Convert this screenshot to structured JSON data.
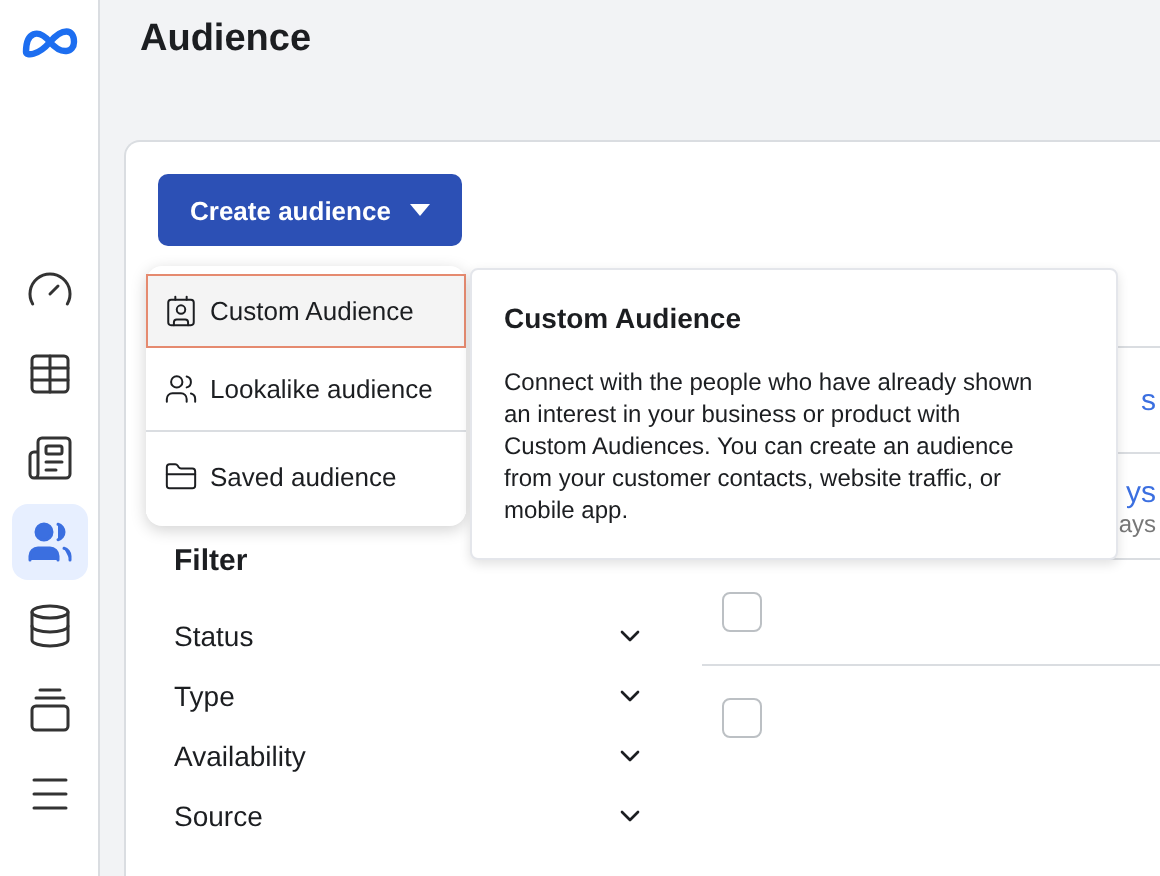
{
  "sidebar": {
    "items": [
      {
        "selected": false
      },
      {
        "selected": false
      },
      {
        "selected": false
      },
      {
        "selected": true
      },
      {
        "selected": false
      },
      {
        "selected": false
      },
      {
        "selected": false
      }
    ]
  },
  "page_title": "Audience",
  "create_button": {
    "label": "Create audience",
    "expanded": true
  },
  "dropdown": {
    "items": [
      {
        "label": "Custom Audience",
        "selected": true
      },
      {
        "label": "Lookalike audience",
        "selected": false
      },
      {
        "label": "Saved audience",
        "selected": false
      }
    ]
  },
  "tooltip": {
    "title": "Custom Audience",
    "body": "Connect with the people who have already shown an interest in your business or product with Custom Audiences. You can create an audience from your customer contacts, website traffic, or mobile app."
  },
  "filter": {
    "title": "Filter",
    "items": [
      {
        "label": "Status",
        "expanded": false
      },
      {
        "label": "Type",
        "expanded": false
      },
      {
        "label": "Availability",
        "expanded": false
      },
      {
        "label": "Source",
        "expanded": false
      }
    ]
  },
  "table": {
    "rows": [
      {
        "kind": "text",
        "link": "s"
      },
      {
        "kind": "text",
        "link": "ys",
        "sub": "ays"
      },
      {
        "kind": "checkbox",
        "checked": false
      },
      {
        "kind": "checkbox",
        "checked": false
      }
    ]
  }
}
